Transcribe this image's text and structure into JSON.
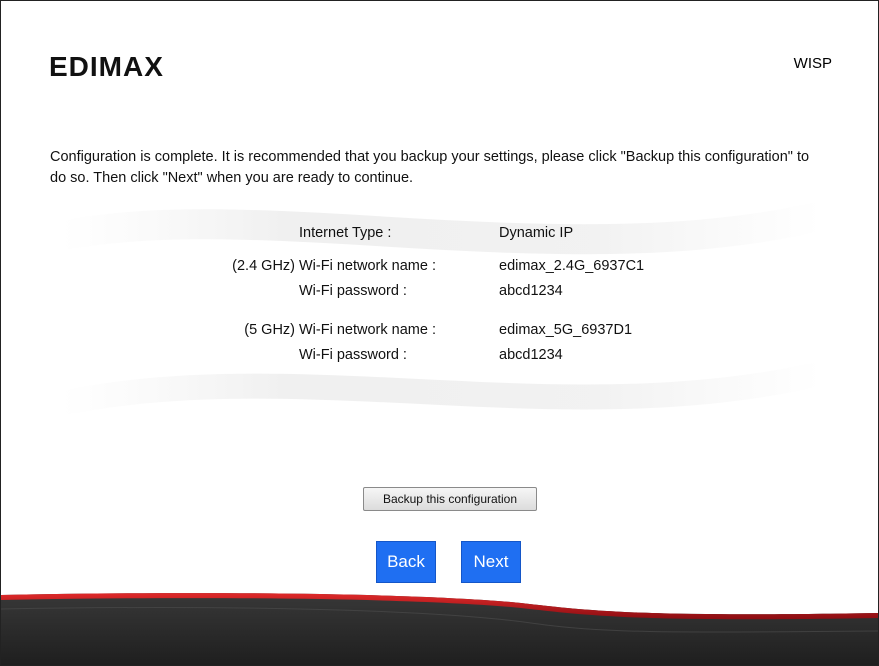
{
  "header": {
    "brand": "EDIMAX",
    "mode": "WISP"
  },
  "intro": {
    "text": "Configuration is complete. It is recommended that you backup your settings, please click \"Backup this configuration\" to do so. Then click \"Next\" when you are ready to continue."
  },
  "summary": {
    "internet_type_label": "Internet Type :",
    "internet_type_value": "Dynamic IP",
    "band_24": "(2.4 GHz)",
    "wifi24_name_label": "Wi-Fi network name :",
    "wifi24_name_value": "edimax_2.4G_6937C1",
    "wifi24_pass_label": "Wi-Fi password :",
    "wifi24_pass_value": "abcd1234",
    "band_5": "(5 GHz)",
    "wifi5_name_label": "Wi-Fi network name :",
    "wifi5_name_value": "edimax_5G_6937D1",
    "wifi5_pass_label": "Wi-Fi password :",
    "wifi5_pass_value": "abcd1234"
  },
  "buttons": {
    "backup_label": "Backup this configuration",
    "back_label": "Back",
    "next_label": "Next"
  },
  "colors": {
    "nav_button": "#1f6ff2",
    "footer_dark": "#2b2b2b",
    "footer_red": "#c0141b"
  }
}
